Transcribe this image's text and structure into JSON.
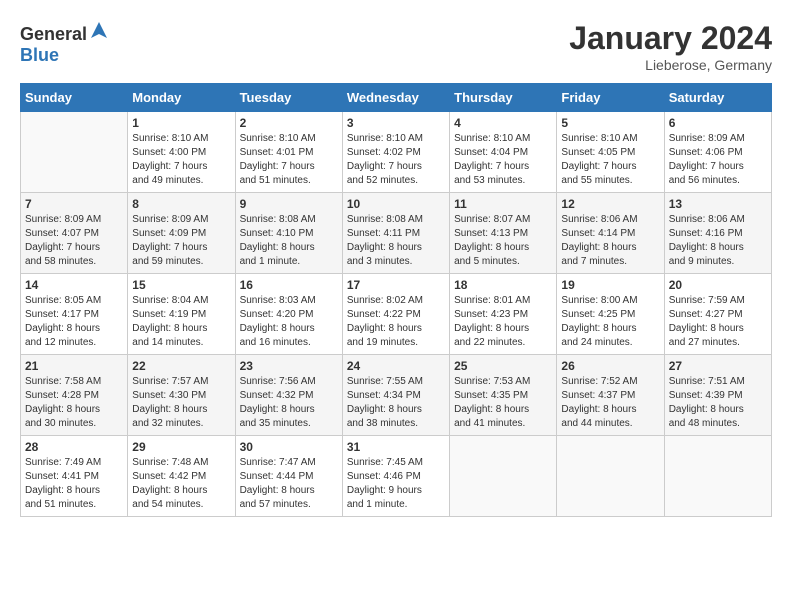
{
  "header": {
    "logo_general": "General",
    "logo_blue": "Blue",
    "month_title": "January 2024",
    "location": "Lieberose, Germany"
  },
  "weekdays": [
    "Sunday",
    "Monday",
    "Tuesday",
    "Wednesday",
    "Thursday",
    "Friday",
    "Saturday"
  ],
  "weeks": [
    [
      {
        "day": "",
        "info": ""
      },
      {
        "day": "1",
        "info": "Sunrise: 8:10 AM\nSunset: 4:00 PM\nDaylight: 7 hours\nand 49 minutes."
      },
      {
        "day": "2",
        "info": "Sunrise: 8:10 AM\nSunset: 4:01 PM\nDaylight: 7 hours\nand 51 minutes."
      },
      {
        "day": "3",
        "info": "Sunrise: 8:10 AM\nSunset: 4:02 PM\nDaylight: 7 hours\nand 52 minutes."
      },
      {
        "day": "4",
        "info": "Sunrise: 8:10 AM\nSunset: 4:04 PM\nDaylight: 7 hours\nand 53 minutes."
      },
      {
        "day": "5",
        "info": "Sunrise: 8:10 AM\nSunset: 4:05 PM\nDaylight: 7 hours\nand 55 minutes."
      },
      {
        "day": "6",
        "info": "Sunrise: 8:09 AM\nSunset: 4:06 PM\nDaylight: 7 hours\nand 56 minutes."
      }
    ],
    [
      {
        "day": "7",
        "info": "Sunrise: 8:09 AM\nSunset: 4:07 PM\nDaylight: 7 hours\nand 58 minutes."
      },
      {
        "day": "8",
        "info": "Sunrise: 8:09 AM\nSunset: 4:09 PM\nDaylight: 7 hours\nand 59 minutes."
      },
      {
        "day": "9",
        "info": "Sunrise: 8:08 AM\nSunset: 4:10 PM\nDaylight: 8 hours\nand 1 minute."
      },
      {
        "day": "10",
        "info": "Sunrise: 8:08 AM\nSunset: 4:11 PM\nDaylight: 8 hours\nand 3 minutes."
      },
      {
        "day": "11",
        "info": "Sunrise: 8:07 AM\nSunset: 4:13 PM\nDaylight: 8 hours\nand 5 minutes."
      },
      {
        "day": "12",
        "info": "Sunrise: 8:06 AM\nSunset: 4:14 PM\nDaylight: 8 hours\nand 7 minutes."
      },
      {
        "day": "13",
        "info": "Sunrise: 8:06 AM\nSunset: 4:16 PM\nDaylight: 8 hours\nand 9 minutes."
      }
    ],
    [
      {
        "day": "14",
        "info": "Sunrise: 8:05 AM\nSunset: 4:17 PM\nDaylight: 8 hours\nand 12 minutes."
      },
      {
        "day": "15",
        "info": "Sunrise: 8:04 AM\nSunset: 4:19 PM\nDaylight: 8 hours\nand 14 minutes."
      },
      {
        "day": "16",
        "info": "Sunrise: 8:03 AM\nSunset: 4:20 PM\nDaylight: 8 hours\nand 16 minutes."
      },
      {
        "day": "17",
        "info": "Sunrise: 8:02 AM\nSunset: 4:22 PM\nDaylight: 8 hours\nand 19 minutes."
      },
      {
        "day": "18",
        "info": "Sunrise: 8:01 AM\nSunset: 4:23 PM\nDaylight: 8 hours\nand 22 minutes."
      },
      {
        "day": "19",
        "info": "Sunrise: 8:00 AM\nSunset: 4:25 PM\nDaylight: 8 hours\nand 24 minutes."
      },
      {
        "day": "20",
        "info": "Sunrise: 7:59 AM\nSunset: 4:27 PM\nDaylight: 8 hours\nand 27 minutes."
      }
    ],
    [
      {
        "day": "21",
        "info": "Sunrise: 7:58 AM\nSunset: 4:28 PM\nDaylight: 8 hours\nand 30 minutes."
      },
      {
        "day": "22",
        "info": "Sunrise: 7:57 AM\nSunset: 4:30 PM\nDaylight: 8 hours\nand 32 minutes."
      },
      {
        "day": "23",
        "info": "Sunrise: 7:56 AM\nSunset: 4:32 PM\nDaylight: 8 hours\nand 35 minutes."
      },
      {
        "day": "24",
        "info": "Sunrise: 7:55 AM\nSunset: 4:34 PM\nDaylight: 8 hours\nand 38 minutes."
      },
      {
        "day": "25",
        "info": "Sunrise: 7:53 AM\nSunset: 4:35 PM\nDaylight: 8 hours\nand 41 minutes."
      },
      {
        "day": "26",
        "info": "Sunrise: 7:52 AM\nSunset: 4:37 PM\nDaylight: 8 hours\nand 44 minutes."
      },
      {
        "day": "27",
        "info": "Sunrise: 7:51 AM\nSunset: 4:39 PM\nDaylight: 8 hours\nand 48 minutes."
      }
    ],
    [
      {
        "day": "28",
        "info": "Sunrise: 7:49 AM\nSunset: 4:41 PM\nDaylight: 8 hours\nand 51 minutes."
      },
      {
        "day": "29",
        "info": "Sunrise: 7:48 AM\nSunset: 4:42 PM\nDaylight: 8 hours\nand 54 minutes."
      },
      {
        "day": "30",
        "info": "Sunrise: 7:47 AM\nSunset: 4:44 PM\nDaylight: 8 hours\nand 57 minutes."
      },
      {
        "day": "31",
        "info": "Sunrise: 7:45 AM\nSunset: 4:46 PM\nDaylight: 9 hours\nand 1 minute."
      },
      {
        "day": "",
        "info": ""
      },
      {
        "day": "",
        "info": ""
      },
      {
        "day": "",
        "info": ""
      }
    ]
  ]
}
